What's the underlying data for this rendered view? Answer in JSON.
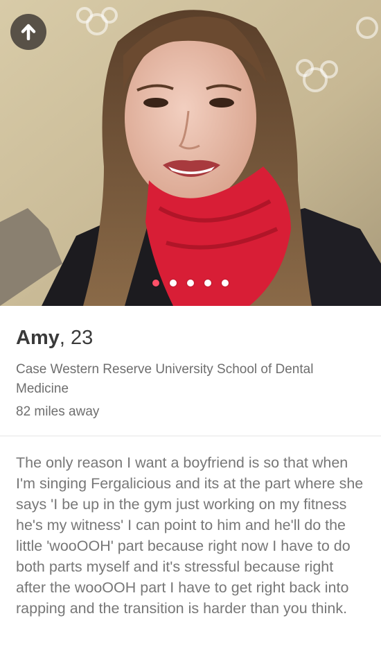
{
  "profile": {
    "name": "Amy",
    "age_text": ", 23",
    "school": "Case Western Reserve University School of Dental Medicine",
    "distance": "82 miles away",
    "bio": "The only reason I want a boyfriend is so that when I'm singing Fergalicious and its at the part where she says 'I be up in the gym just working on my fitness he's my witness' I can point to him and he'll do the little 'wooOOH' part because right now I have to do both parts myself and it's stressful because right after the wooOOH part I have to get right back into rapping and the transition is harder than you think."
  },
  "photo": {
    "count": 5,
    "active_index": 0
  },
  "icons": {
    "back": "arrow-up-icon"
  },
  "colors": {
    "accent": "#fd5068",
    "name_text": "#3a3a3a",
    "secondary_text": "#6e6e6e"
  }
}
